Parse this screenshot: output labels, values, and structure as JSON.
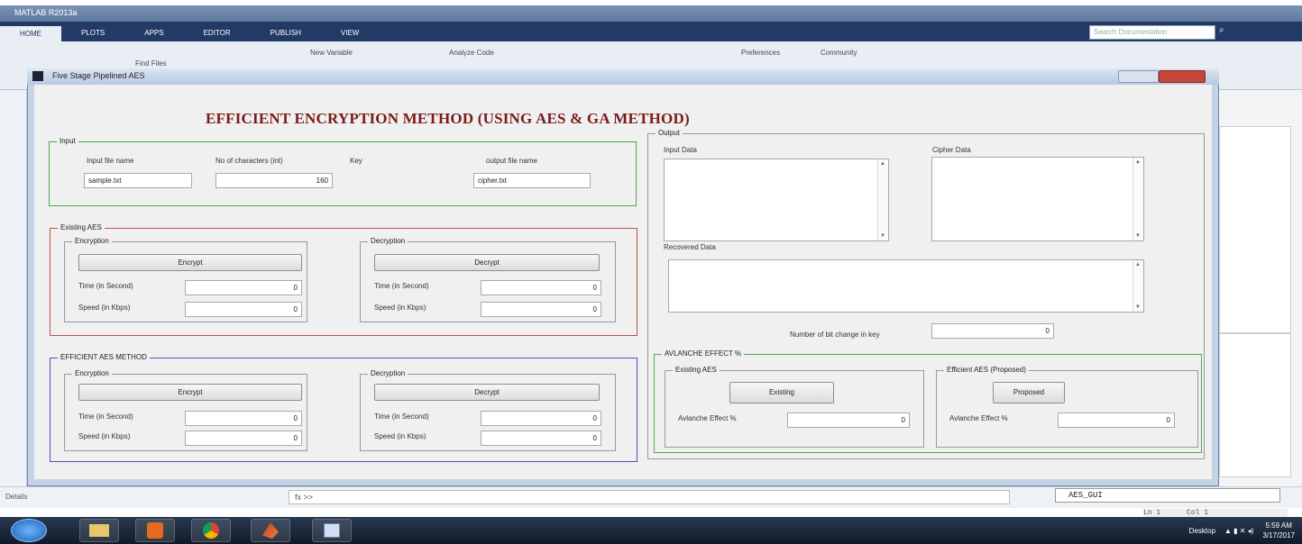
{
  "matlab": {
    "title": "MATLAB R2013a",
    "tabs": [
      "HOME",
      "PLOTS",
      "APPS",
      "EDITOR",
      "PUBLISH",
      "VIEW"
    ],
    "search_placeholder": "Search Documentation",
    "toolbar": {
      "new_variable": "New Variable",
      "analyze_code": "Analyze Code",
      "preferences": "Preferences",
      "community": "Community",
      "find_files": "Find Files"
    },
    "details_label": "Details",
    "fx": "fx >>",
    "current_file": "AES_GUI",
    "status_ln": "Ln 1",
    "status_col": "Col 1"
  },
  "taskbar": {
    "desktop_label": "Desktop",
    "time": "5:59 AM",
    "date": "3/17/2017"
  },
  "gui": {
    "window_title": "Five Stage Pipelined AES",
    "heading": "EFFICIENT ENCRYPTION METHOD (USING AES & GA METHOD)",
    "input": {
      "legend": "Input",
      "file_label": "Input file name",
      "chars_label": "No of characters (int)",
      "key_label": "Key",
      "output_label": "output file name",
      "file_value": "sample.txt",
      "chars_value": "160",
      "output_value": "cipher.txt"
    },
    "existing_aes": {
      "legend": "Existing AES",
      "enc_legend": "Encryption",
      "dec_legend": "Decryption",
      "encrypt_button": "Encrypt",
      "decrypt_button": "Decrypt",
      "time_label": "Time (in Second)",
      "speed_label": "Speed (in Kbps)",
      "enc_time": "0",
      "enc_speed": "0",
      "dec_time": "0",
      "dec_speed": "0"
    },
    "efficient_aes": {
      "legend": "EFFICIENT AES METHOD",
      "enc_legend": "Encryption",
      "dec_legend": "Decryption",
      "encrypt_button": "Encrypt",
      "decrypt_button": "Decrypt",
      "time_label": "Time (in Second)",
      "speed_label": "Speed (in Kbps)",
      "enc_time": "0",
      "enc_speed": "0",
      "dec_time": "0",
      "dec_speed": "0"
    },
    "output": {
      "legend": "Output",
      "input_data_label": "Input Data",
      "cipher_data_label": "Cipher Data",
      "recovered_label": "Recovered Data",
      "bit_change_label": "Number of bit change in key",
      "bit_change_value": "0"
    },
    "avalanche": {
      "legend": "AVLANCHE EFFECT %",
      "existing_legend": "Existing AES",
      "proposed_legend": "Efficient AES (Proposed)",
      "existing_button": "Existing",
      "proposed_button": "Proposed",
      "effect_label": "Avlanche Effect %",
      "existing_value": "0",
      "proposed_value": "0"
    }
  }
}
